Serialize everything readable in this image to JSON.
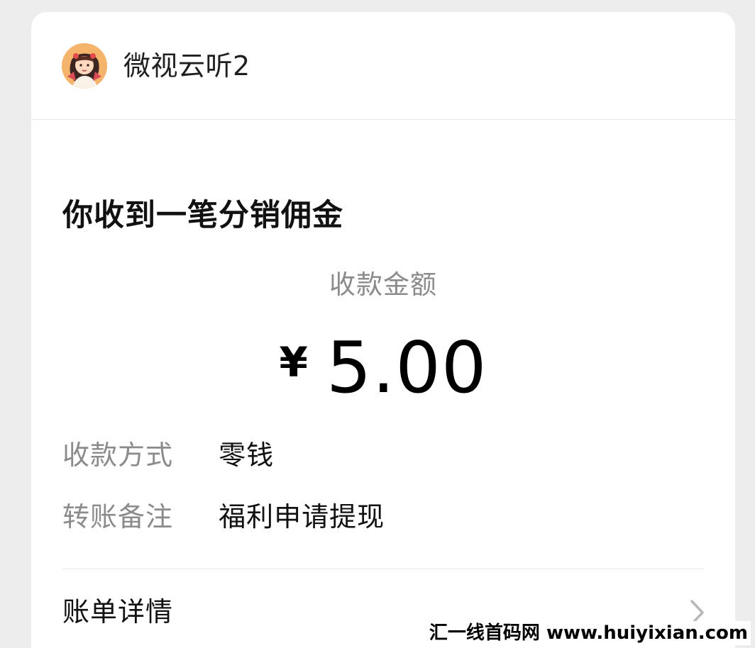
{
  "header": {
    "account_name": "微视云听2",
    "avatar_icon": "anime-character-avatar-icon"
  },
  "message": {
    "headline": "你收到一笔分销佣金",
    "amount_label": "收款金额",
    "currency_symbol": "¥",
    "amount": "5.00"
  },
  "details": [
    {
      "label": "收款方式",
      "value": "零钱"
    },
    {
      "label": "转账备注",
      "value": "福利申请提现"
    }
  ],
  "footer": {
    "bill_details_label": "账单详情",
    "chevron_icon": "chevron-right-icon"
  },
  "watermark": {
    "text": "汇一线首码网 www.huiyixian.com"
  },
  "colors": {
    "background": "#ededed",
    "card": "#ffffff",
    "primary_text": "#111111",
    "secondary_text": "#8b8b8b",
    "divider": "#e5e5e5"
  }
}
